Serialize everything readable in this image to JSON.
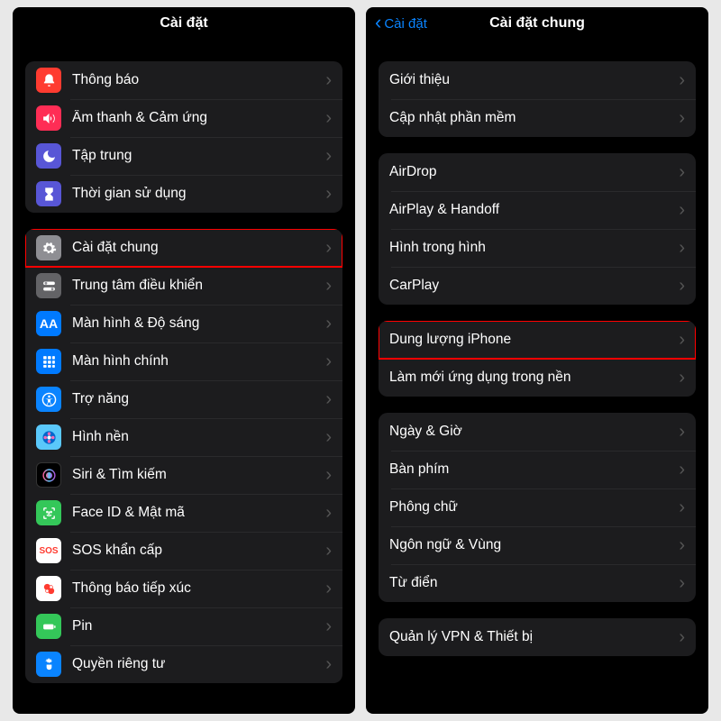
{
  "left": {
    "title": "Cài đặt",
    "group1": [
      {
        "label": "Thông báo",
        "icon": "bell-icon",
        "bg": "bg-red"
      },
      {
        "label": "Âm thanh & Cảm ứng",
        "icon": "sound-icon",
        "bg": "bg-pink"
      },
      {
        "label": "Tập trung",
        "icon": "moon-icon",
        "bg": "bg-indigo"
      },
      {
        "label": "Thời gian sử dụng",
        "icon": "hourglass-icon",
        "bg": "bg-indigo"
      }
    ],
    "group2": [
      {
        "label": "Cài đặt chung",
        "icon": "gear-icon",
        "bg": "bg-gray",
        "highlight": true
      },
      {
        "label": "Trung tâm điều khiển",
        "icon": "switches-icon",
        "bg": "bg-gray2"
      },
      {
        "label": "Màn hình & Độ sáng",
        "icon": "aa-icon",
        "bg": "bg-blue",
        "text": "AA"
      },
      {
        "label": "Màn hình chính",
        "icon": "grid-icon",
        "bg": "bg-blue"
      },
      {
        "label": "Trợ năng",
        "icon": "accessibility-icon",
        "bg": "bg-blue2"
      },
      {
        "label": "Hình nền",
        "icon": "flower-icon",
        "bg": "bg-lightblue"
      },
      {
        "label": "Siri & Tìm kiếm",
        "icon": "siri-icon",
        "bg": "bg-black"
      },
      {
        "label": "Face ID & Mật mã",
        "icon": "faceid-icon",
        "bg": "bg-green"
      },
      {
        "label": "SOS khẩn cấp",
        "icon": "sos-icon",
        "bg": "bg-sos",
        "text": "SOS"
      },
      {
        "label": "Thông báo tiếp xúc",
        "icon": "exposure-icon",
        "bg": "bg-exposure"
      },
      {
        "label": "Pin",
        "icon": "battery-icon",
        "bg": "bg-green"
      },
      {
        "label": "Quyền riêng tư",
        "icon": "hand-icon",
        "bg": "bg-blue2"
      }
    ]
  },
  "right": {
    "back": "Cài đặt",
    "title": "Cài đặt chung",
    "group1": [
      {
        "label": "Giới thiệu"
      },
      {
        "label": "Cập nhật phần mềm"
      }
    ],
    "group2": [
      {
        "label": "AirDrop"
      },
      {
        "label": "AirPlay & Handoff"
      },
      {
        "label": "Hình trong hình"
      },
      {
        "label": "CarPlay"
      }
    ],
    "group3": [
      {
        "label": "Dung lượng iPhone",
        "highlight": true
      },
      {
        "label": "Làm mới ứng dụng trong nền"
      }
    ],
    "group4": [
      {
        "label": "Ngày & Giờ"
      },
      {
        "label": "Bàn phím"
      },
      {
        "label": "Phông chữ"
      },
      {
        "label": "Ngôn ngữ & Vùng"
      },
      {
        "label": "Từ điển"
      }
    ],
    "group5": [
      {
        "label": "Quản lý VPN & Thiết bị"
      }
    ]
  }
}
